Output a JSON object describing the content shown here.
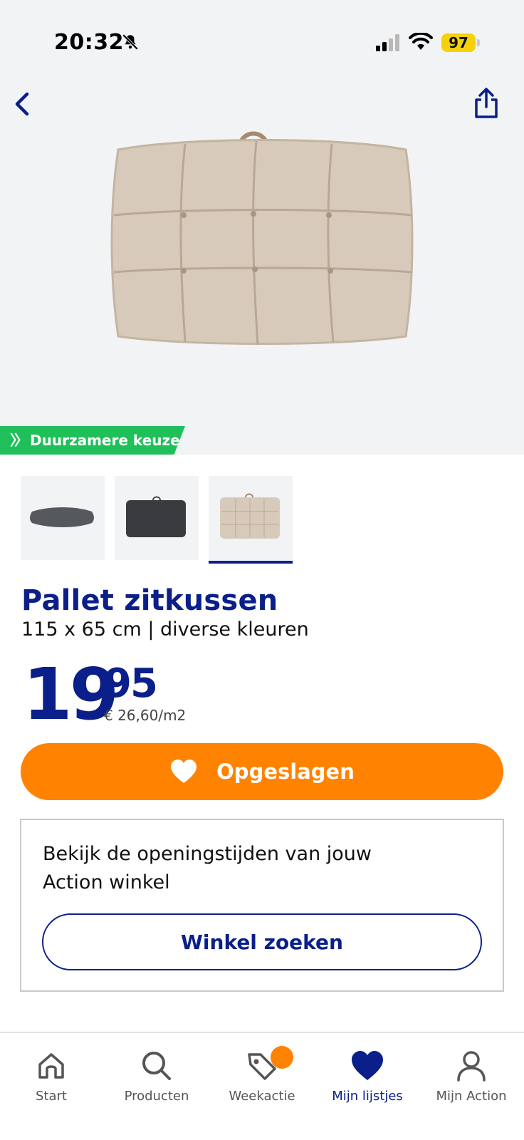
{
  "status_bar": {
    "time": "20:32",
    "battery": "97"
  },
  "product": {
    "badge": "Duurzamere keuze",
    "title": "Pallet zitkussen",
    "subtitle": "115 x 65 cm | diverse kleuren",
    "price_whole": "19",
    "price_decimals": "95",
    "unit_price": "€ 26,60/m2",
    "thumbnails": [
      "grey-cushion-thumb",
      "dark-cushion-thumb",
      "beige-cushion-thumb"
    ],
    "selected_thumbnail": 2
  },
  "actions": {
    "saved_label": "Opgeslagen"
  },
  "store": {
    "text": "Bekijk de openingstijden van jouw Action winkel",
    "button": "Winkel zoeken"
  },
  "nav": {
    "items": [
      {
        "label": "Start",
        "icon": "home-icon"
      },
      {
        "label": "Producten",
        "icon": "search-icon"
      },
      {
        "label": "Weekactie",
        "icon": "tag-icon"
      },
      {
        "label": "Mijn lijstjes",
        "icon": "heart-icon"
      },
      {
        "label": "Mijn Action",
        "icon": "user-icon"
      }
    ],
    "active": "Mijn lijstjes"
  },
  "colors": {
    "brand_blue": "#0b1f8a",
    "accent_orange": "#ff8200",
    "sustain_green": "#1fbf5a",
    "battery_yellow": "#f5d10a"
  }
}
